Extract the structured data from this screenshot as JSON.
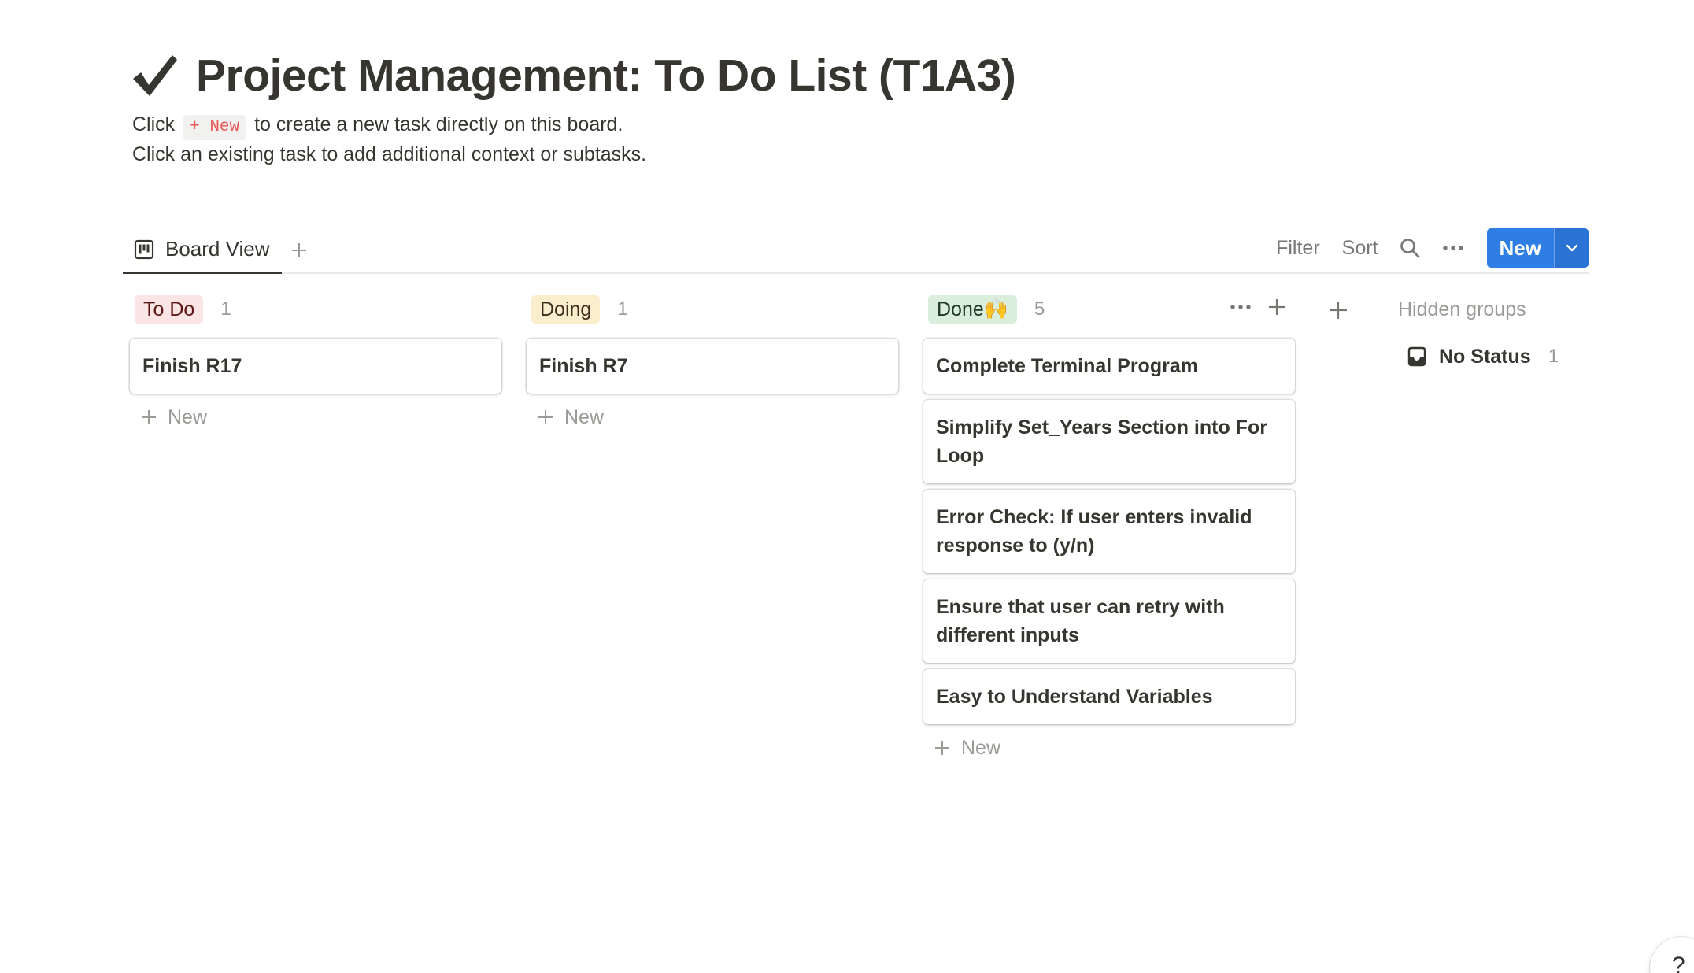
{
  "page": {
    "title": "Project Management: To Do List (T1A3)",
    "description": {
      "line1_before": "Click",
      "chip": "+ New",
      "line1_after": "to create a new task directly on this board.",
      "line2": "Click an existing task to add additional context or subtasks."
    }
  },
  "tabs": [
    {
      "label": "Board View",
      "icon": "board-icon"
    }
  ],
  "toolbar": {
    "filter": "Filter",
    "sort": "Sort",
    "new": "New"
  },
  "columns": [
    {
      "name": "To Do",
      "count": "1",
      "color_bg": "#fbe4e4",
      "color_text": "#5d1715",
      "cards": [
        "Finish R17"
      ],
      "add_label": "New"
    },
    {
      "name": "Doing",
      "count": "1",
      "color_bg": "#fbeecc",
      "color_text": "#402c1b",
      "cards": [
        "Finish R7"
      ],
      "add_label": "New"
    },
    {
      "name": "Done🙌",
      "count": "5",
      "color_bg": "#dbeddb",
      "color_text": "#1c3829",
      "cards": [
        "Complete Terminal Program",
        "Simplify Set_Years Section into For Loop",
        "Error Check: If user enters invalid response to (y/n)",
        "Ensure that user can retry with different inputs",
        "Easy to Understand Variables"
      ],
      "add_label": "New"
    }
  ],
  "hidden_groups": {
    "title": "Hidden groups",
    "items": [
      {
        "label": "No Status",
        "count": "1",
        "icon": "inbox-icon"
      }
    ]
  },
  "help": {
    "label": "?"
  }
}
